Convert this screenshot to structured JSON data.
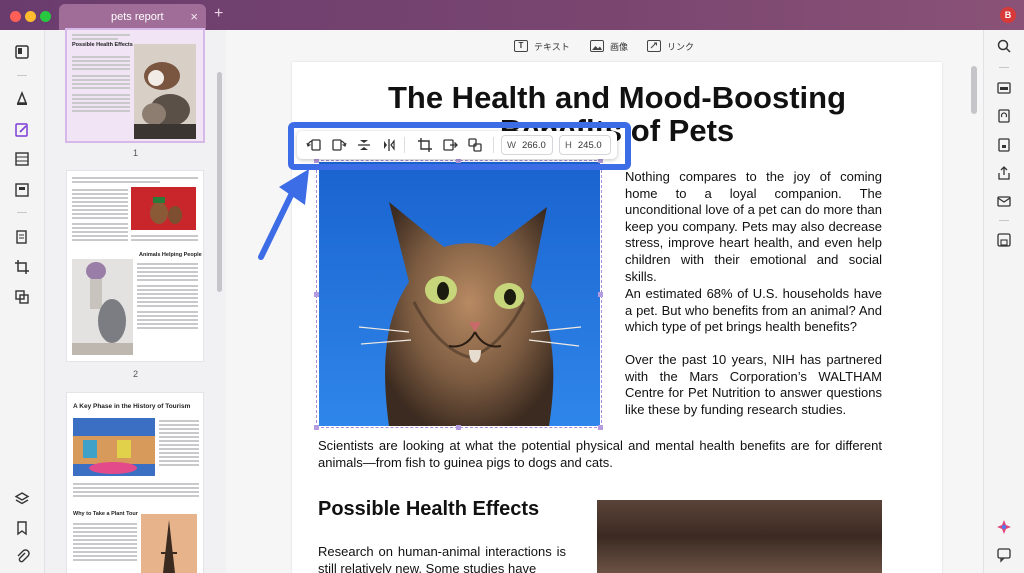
{
  "window": {
    "tab_title": "pets report",
    "tab_close": "×",
    "tab_add": "+",
    "user_initial": "B"
  },
  "toolbar": {
    "text_label": "テキスト",
    "image_label": "画像",
    "link_label": "リンク"
  },
  "image_toolbar": {
    "width_label": "W",
    "width_value": "266.0",
    "height_label": "H",
    "height_value": "245.0"
  },
  "thumbnails": [
    {
      "page_number": "1",
      "heading": "Possible Health Effects"
    },
    {
      "page_number": "2",
      "heading": "Animals Helping People"
    },
    {
      "heading": "A Key Phase in the History of Tourism",
      "subheading": "Why to Take a Plant Tour"
    }
  ],
  "document": {
    "title_line1": "The Health and Mood-Boosting",
    "title_line2": "Benefits of Pets",
    "para1": "Nothing compares to the joy of coming home to a loyal companion. The unconditional love of a pet can do more than keep you company. Pets may also decrease stress, improve heart health, and even help children with their emotional and social skills.",
    "para2": "An estimated 68% of U.S. households have a pet. But who benefits from an animal? And which type of pet brings health benefits?",
    "para3": "Over the past 10 years, NIH has partnered with the Mars Corporation’s WALTHAM Centre for Pet Nutrition to answer questions like these by funding research studies.",
    "para4": "Scientists are looking at what the potential physical and mental health benefits are for different animals—from fish to guinea pigs to dogs and cats.",
    "heading2": "Possible Health Effects",
    "para5": "Research on human-animal interactions is still relatively new. Some studies have"
  },
  "colors": {
    "accent_purple": "#7b3bd6",
    "highlight_blue": "#3d6de6",
    "sky_blue": "#1f6fd6"
  }
}
